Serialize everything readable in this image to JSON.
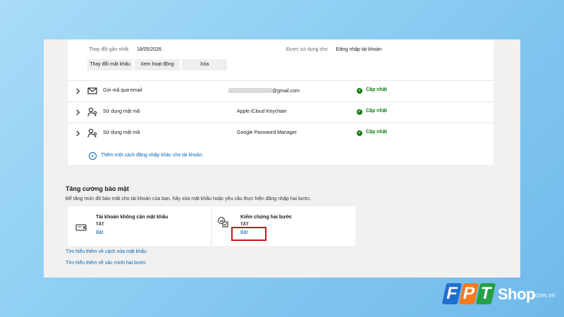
{
  "details": {
    "last_change_label": "Thay đổi gần nhất",
    "last_change_value": "18/05/2026",
    "used_for_label": "Được sử dụng cho",
    "used_for_value": "Đăng nhập tài khoản",
    "buttons": {
      "change_password": "Thay đổi mật khẩu",
      "view_activity": "Xem hoạt động",
      "delete": "Xóa"
    }
  },
  "methods": [
    {
      "label": "Gửi mã qua email",
      "value": "@gmail.com",
      "status": "Cập nhật",
      "icon": "mail-icon"
    },
    {
      "label": "Sử dụng mật mã",
      "value": "Apple iCloud Keychain",
      "status": "Cập nhật",
      "icon": "passkey-icon"
    },
    {
      "label": "Sử dụng mật mã",
      "value": "Google Password Manager",
      "status": "Cập nhật",
      "icon": "passkey-icon"
    }
  ],
  "add_method_label": "Thêm một cách đăng nhập khác cho tài khoản.",
  "security": {
    "title": "Tăng cường bảo mật",
    "description": "Để tăng mức độ bảo mật cho tài khoản của bạn, hãy xóa mật khẩu hoặc yêu cầu thực hiện đăng nhập hai bước.",
    "passwordless": {
      "title": "Tài khoản không cần mật khẩu",
      "state": "TẮT",
      "action": "Bật"
    },
    "two_step": {
      "title": "Kiểm chứng hai bước",
      "state": "TẮT",
      "action": "Bật"
    }
  },
  "links": {
    "learn_remove_password": "Tìm hiểu thêm về cách xóa mật khẩu",
    "learn_two_step": "Tìm hiểu thêm về xác minh hai bước"
  },
  "brand": {
    "f": "F",
    "p": "P",
    "t": "T",
    "shop": "Shop",
    "domain": ".com.vn",
    "colors": {
      "blue": "#1f6fd1",
      "orange": "#f47a20",
      "green": "#24a148"
    }
  },
  "colors": {
    "accent_blue": "#0067b8",
    "success_green": "#107c10",
    "highlight_red": "#c8171e"
  }
}
